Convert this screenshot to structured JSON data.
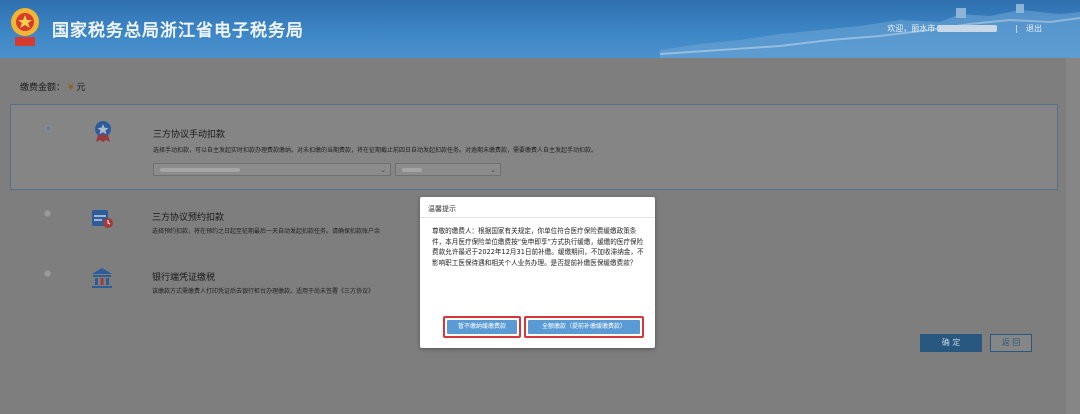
{
  "header": {
    "title": "国家税务总局浙江省电子税务局",
    "welcome": "欢迎，丽水市",
    "separator": "|",
    "logout": "退出",
    "emblem_icon": "tax-emblem-icon"
  },
  "amount": {
    "label": "缴费金额：",
    "currency": "¥",
    "unit": "元"
  },
  "options": [
    {
      "title": "三方协议手动扣款",
      "desc": "选择手动扣款，可以自主发起实时扣款办理费款缴纳。对未扣缴的当期费款，将在征期截止前四日自动发起扣款任务。对逾期未缴费款，需要缴费人自主发起手动扣款。",
      "icon": "medal-icon",
      "selected": true
    },
    {
      "title": "三方协议预约扣款",
      "desc": "选择预约扣款，将在预约之日起至征期最后一天自动发起扣款任务。请确保扣款账户余",
      "icon": "calendar-clock-icon",
      "selected": false
    },
    {
      "title": "银行端凭证缴税",
      "desc": "该缴款方式需缴费人打印凭证后去银行柜台办理缴款。适用于尚未签署《三方协议》",
      "icon": "bank-icon",
      "selected": false
    }
  ],
  "buttons": {
    "confirm": "确 定",
    "back": "返 回"
  },
  "dialog": {
    "title": "温馨提示",
    "body": "尊敬的缴费人：根据国家有关规定，你单位符合医疗保险费缓缴政策条件，本月医疗保险单位缴费按“免申即享”方式执行缓缴，缓缴的医疗保险费款允许最迟于2022年12月31日前补缴。缓缴期间，不加收滞纳金，不影响职工医保待遇和相关个人业务办理。是否提前补缴医保缓缴费款？",
    "btn_defer": "暂不缴纳缓缴费款",
    "btn_pay_all": "全额缴款（提前补缴缓缴费款）"
  },
  "colors": {
    "header_blue": "#3d86c6",
    "dialog_button": "#5a9bd5",
    "highlight_red": "#d8363b",
    "selected_border": "#55708a"
  }
}
